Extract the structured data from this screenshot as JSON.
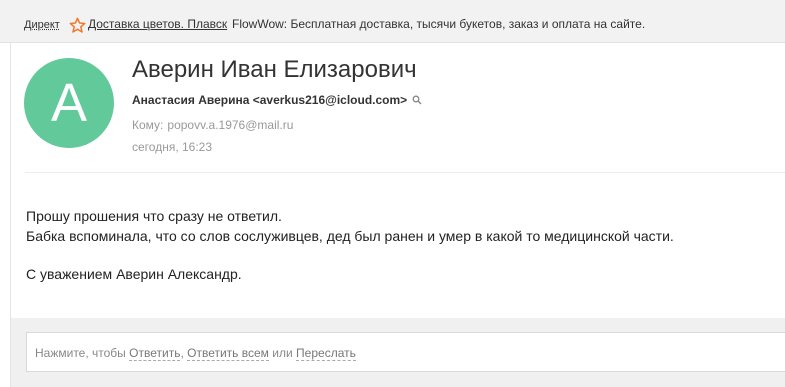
{
  "ad": {
    "direct_label": "Директ",
    "link_text": "Доставка цветов. Плавск",
    "text": "FlowWow: Бесплатная доставка, тысячи букетов, заказ и оплата на сайте."
  },
  "message": {
    "avatar_letter": "А",
    "avatar_color": "#62c99b",
    "subject": "Аверин Иван Елизарович",
    "from": "Анастасия Аверина <averkus216@icloud.com>",
    "to_label": "Кому:",
    "to": "popovv.a.1976@mail.ru",
    "date": "сегодня, 16:23",
    "body": {
      "line1": "Прошу прошения что сразу не ответил.",
      "line2": "Бабка вспоминала, что со слов сослуживцев, дед был ранен и умер в какой то медицинской части.",
      "line3": "С уважением Аверин Александр."
    }
  },
  "reply": {
    "prefix": "Нажмите, чтобы",
    "reply": "Ответить",
    "comma": ",",
    "reply_all": "Ответить всем",
    "or": "или",
    "forward": "Переслать"
  }
}
